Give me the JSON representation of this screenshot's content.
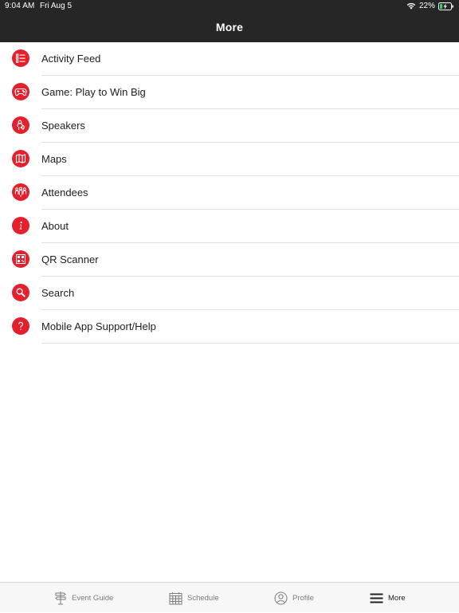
{
  "status_bar": {
    "time": "9:04 AM",
    "date": "Fri Aug 5",
    "battery": "22%"
  },
  "header": {
    "title": "More"
  },
  "colors": {
    "accent": "#e4202d",
    "header_bg": "#262626",
    "tab_bar_bg": "#f7f7f7"
  },
  "menu": {
    "items": [
      {
        "label": "Activity Feed",
        "icon": "activity-feed-icon"
      },
      {
        "label": "Game: Play to Win Big",
        "icon": "game-controller-icon"
      },
      {
        "label": "Speakers",
        "icon": "speaker-icon"
      },
      {
        "label": "Maps",
        "icon": "map-icon"
      },
      {
        "label": "Attendees",
        "icon": "attendees-icon"
      },
      {
        "label": "About",
        "icon": "info-icon"
      },
      {
        "label": "QR Scanner",
        "icon": "qr-code-icon"
      },
      {
        "label": "Search",
        "icon": "search-icon"
      },
      {
        "label": "Mobile App Support/Help",
        "icon": "help-icon"
      }
    ]
  },
  "tabs": [
    {
      "label": "Event Guide",
      "icon": "signpost-icon",
      "active": false
    },
    {
      "label": "Schedule",
      "icon": "calendar-icon",
      "active": false
    },
    {
      "label": "Profile",
      "icon": "profile-icon",
      "active": false
    },
    {
      "label": "More",
      "icon": "menu-icon",
      "active": true
    }
  ]
}
